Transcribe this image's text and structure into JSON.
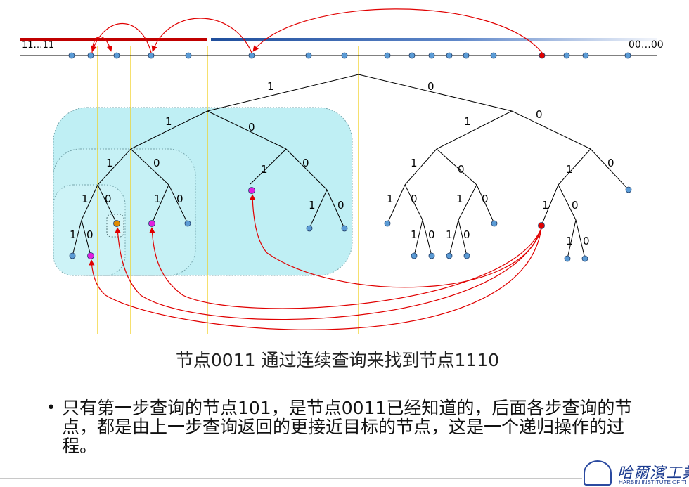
{
  "idspace": {
    "left_label": "11…11",
    "right_label": "00…00"
  },
  "caption": "节点0011 通过连续查询来找到节点1110",
  "bullet": {
    "marker": "•",
    "text": "只有第一步查询的节点101，是节点0011已经知道的，后面各步查询的节点，都是由上一步查询返回的更接近目标的节点，这是一个递归操作的过程。"
  },
  "logo": {
    "name_cn": "哈爾濱工業大",
    "name_en": "HARBIN INSTITUTE OF TECHNO"
  },
  "colors": {
    "red_bar": "#c00000",
    "blue_bar": "#1f4e9c",
    "node_blue": "#5b9bd5",
    "node_red": "#e00000",
    "node_magenta": "#e020e0",
    "node_orange": "#e08a00",
    "region_fill": "#bfeff4",
    "guide_line": "#f0d020",
    "arrow": "#e00000"
  }
}
